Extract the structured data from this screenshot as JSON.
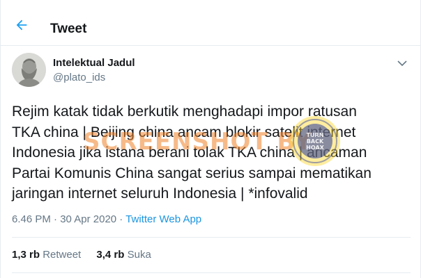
{
  "header": {
    "title": "Tweet",
    "back_icon": "arrow-left-icon"
  },
  "author": {
    "display_name": "Intelektual Jadul",
    "handle": "@plato_ids",
    "avatar": "avatar-image",
    "menu_icon": "chevron-down-icon"
  },
  "tweet": {
    "lines": [
      "Rejim katak tidak berkutik menghadapi impor ratusan",
      "TKA china | Beijing china ancam blokir satelit internet",
      "Indonesia jika istana berani tolak TKA china | ancaman",
      "Partai Komunis China sangat serius sampai mematikan",
      "jaringan internet seluruh Indonesia | *infovalid"
    ]
  },
  "meta": {
    "time": "6.46 PM",
    "separator": " · ",
    "date": "30 Apr 2020",
    "source": "Twitter Web App"
  },
  "stats": {
    "retweets_count": "1,3 rb",
    "retweets_label": " Retweet",
    "likes_count": "3,4 rb",
    "likes_label": " Suka"
  },
  "watermark": {
    "text": "SCREENSHOT BY",
    "logo_text": "TURN BACK HOAX"
  },
  "colors": {
    "accent": "#1da1f2",
    "secondary_text": "#657786",
    "border": "#e6ecf0",
    "watermark": "#ee8228"
  }
}
